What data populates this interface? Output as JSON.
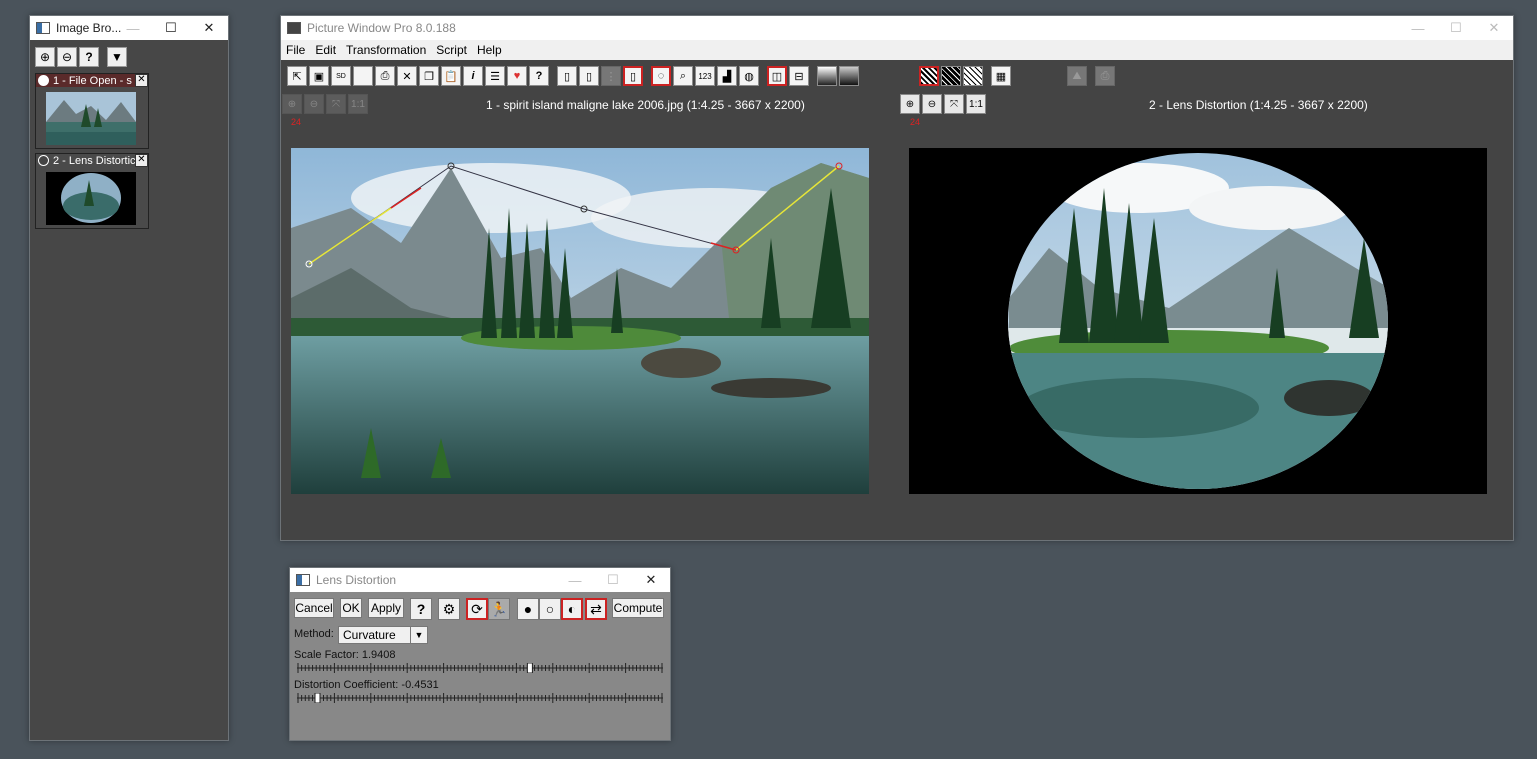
{
  "browser": {
    "title": "Image Bro...",
    "toolbar": [
      "zoom-in-icon",
      "zoom-out-icon",
      "help-icon",
      "dropdown-icon"
    ],
    "items": [
      {
        "label": "1 - File Open - s"
      },
      {
        "label": "2 - Lens Distortic"
      }
    ]
  },
  "main": {
    "title": "Picture Window Pro 8.0.188",
    "menu": [
      "File",
      "Edit",
      "Transformation",
      "Script",
      "Help"
    ],
    "left": {
      "title": "1 - spirit island maligne lake 2006.jpg (1:4.25 - 3667 x 2200)",
      "tag": "24"
    },
    "right": {
      "title": "2 - Lens Distortion (1:4.25 - 3667 x 2200)",
      "tag": "24"
    },
    "zoom_11": "1:1"
  },
  "dialog": {
    "title": "Lens Distortion",
    "cancel": "Cancel",
    "ok": "OK",
    "apply": "Apply",
    "compute": "Compute",
    "method_label": "Method:",
    "method_value": "Curvature",
    "scale_label": "Scale Factor: 1.9408",
    "coef_label": "Distortion Coefficient: -0.4531",
    "scale_level": 0.64,
    "coef_level": 0.05
  },
  "colors": {
    "accent_red": "#cc2222",
    "window_bg": "#444444",
    "desktop": "#4a535b"
  }
}
